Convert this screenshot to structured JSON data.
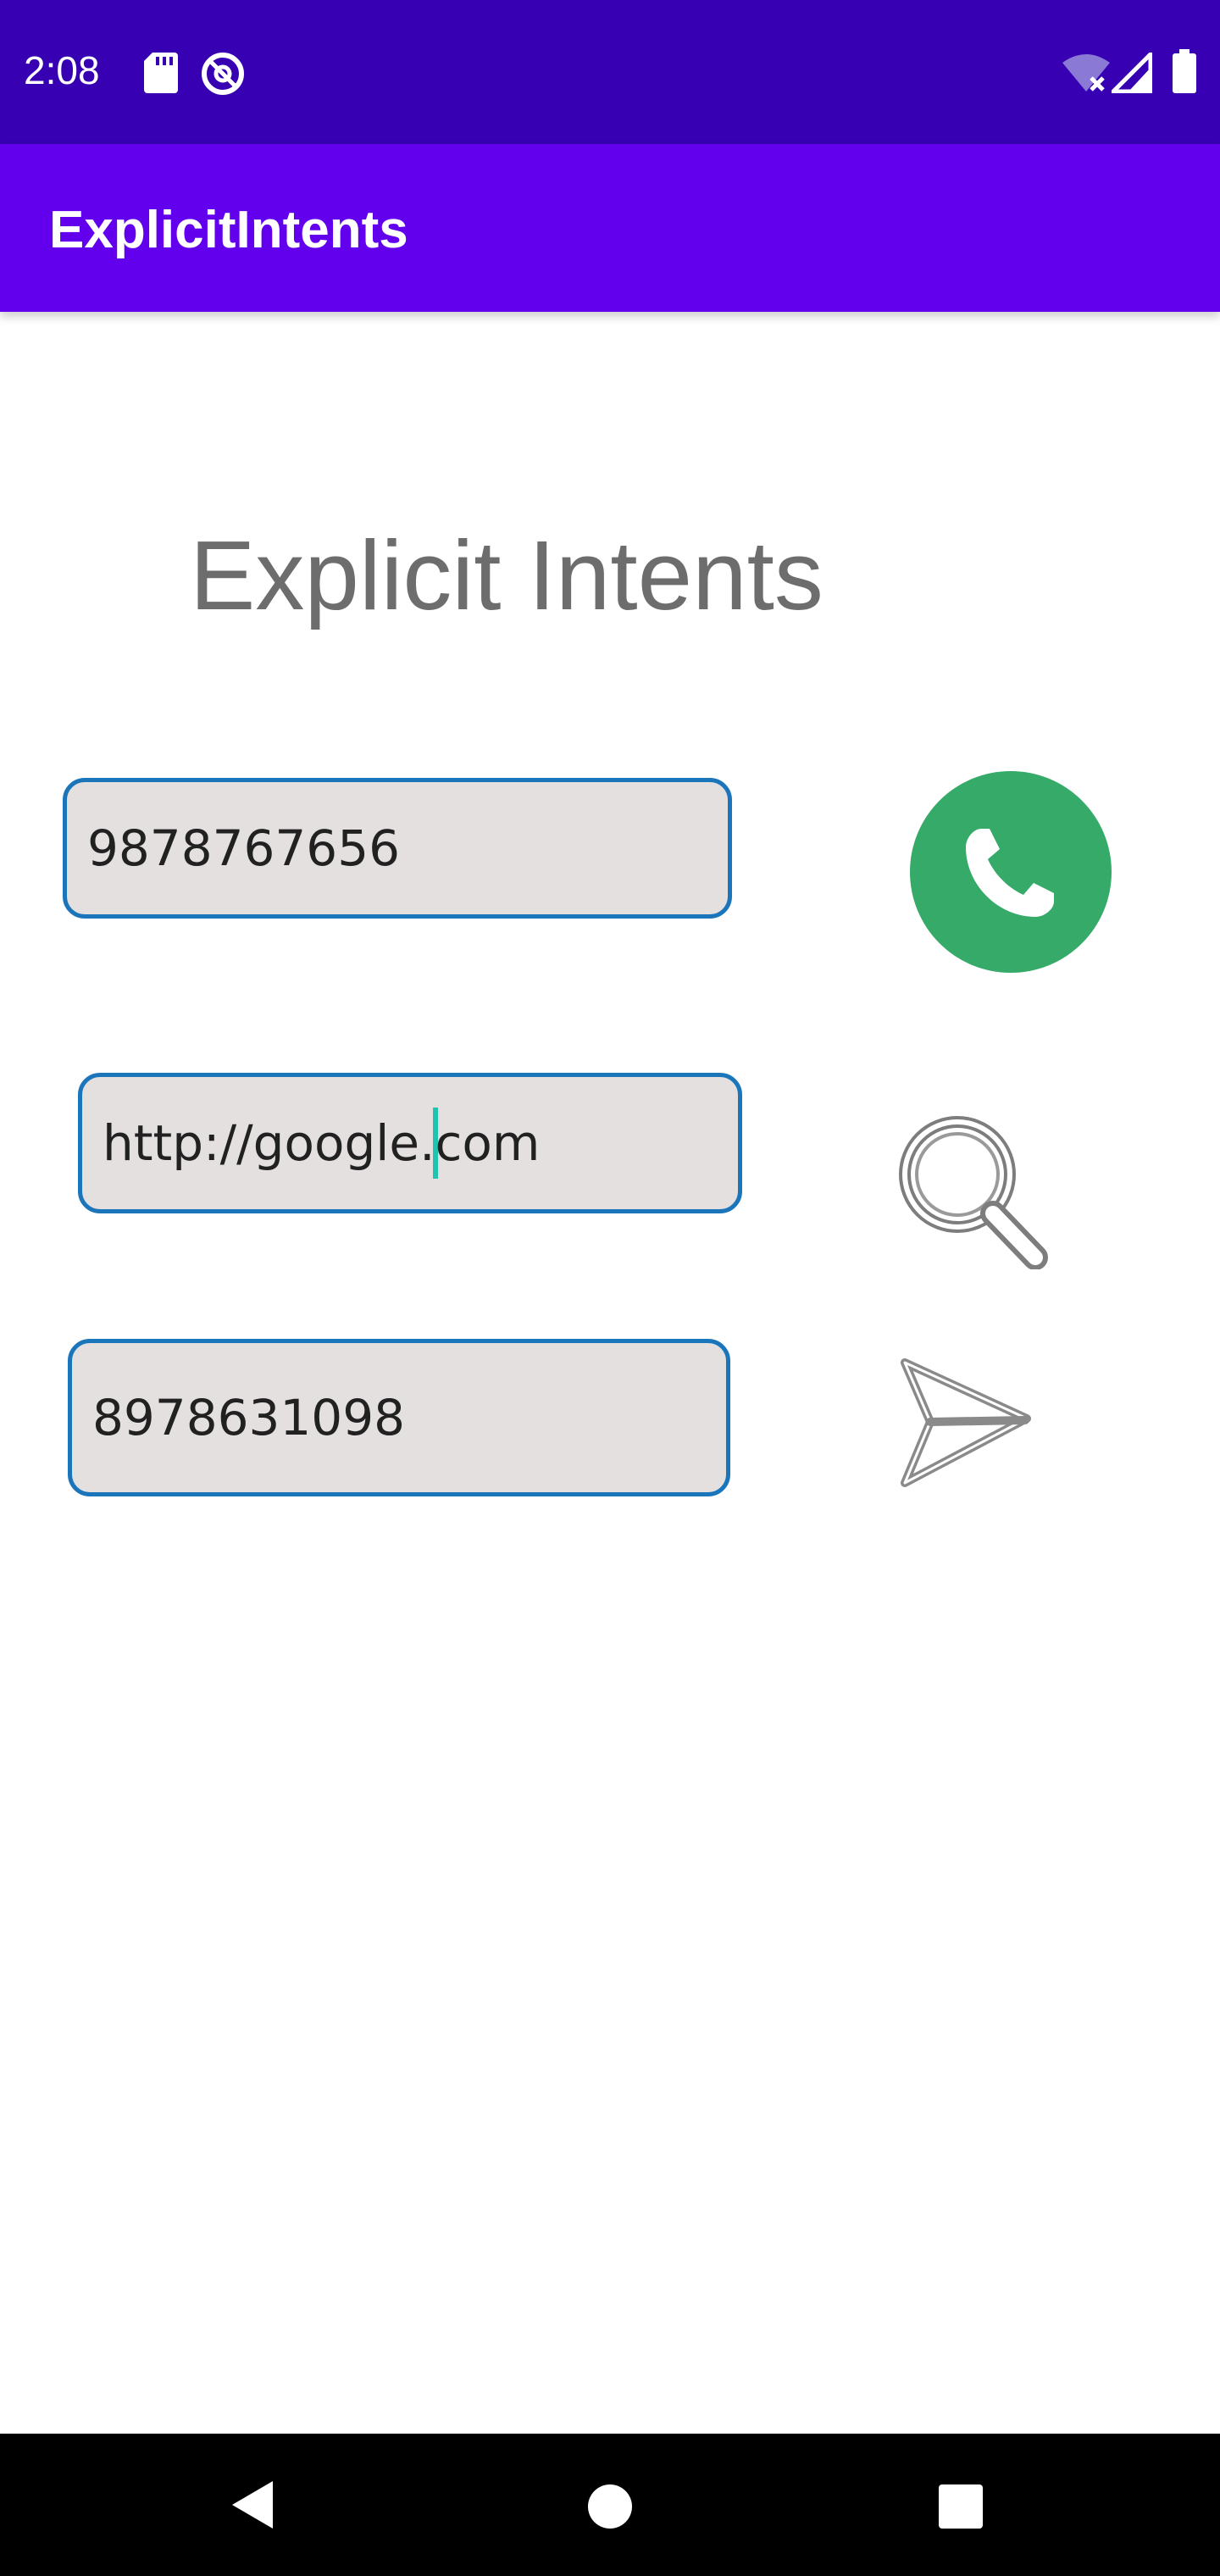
{
  "status_bar": {
    "time": "2:08",
    "icons": [
      "sd-card-icon",
      "sync-icon",
      "wifi-off-icon",
      "signal-icon",
      "battery-icon"
    ]
  },
  "app_bar": {
    "title": "ExplicitIntents"
  },
  "main": {
    "heading": "Explicit Intents",
    "phone_field": {
      "value": "9878767656",
      "action_icon": "phone-call-icon"
    },
    "url_field": {
      "value_before_caret": "http://google.",
      "value_after_caret": "com",
      "action_icon": "search-icon"
    },
    "sms_field": {
      "value": "8978631098",
      "action_icon": "send-icon"
    }
  },
  "nav_bar": {
    "buttons": [
      "back-icon",
      "home-icon",
      "recents-icon"
    ]
  },
  "colors": {
    "status_bar": "#3700b3",
    "app_bar": "#6200ee",
    "field_border": "#1b75bb",
    "field_background": "#e3e0df",
    "call_button": "#35aa69",
    "caret": "#20c3b0"
  }
}
